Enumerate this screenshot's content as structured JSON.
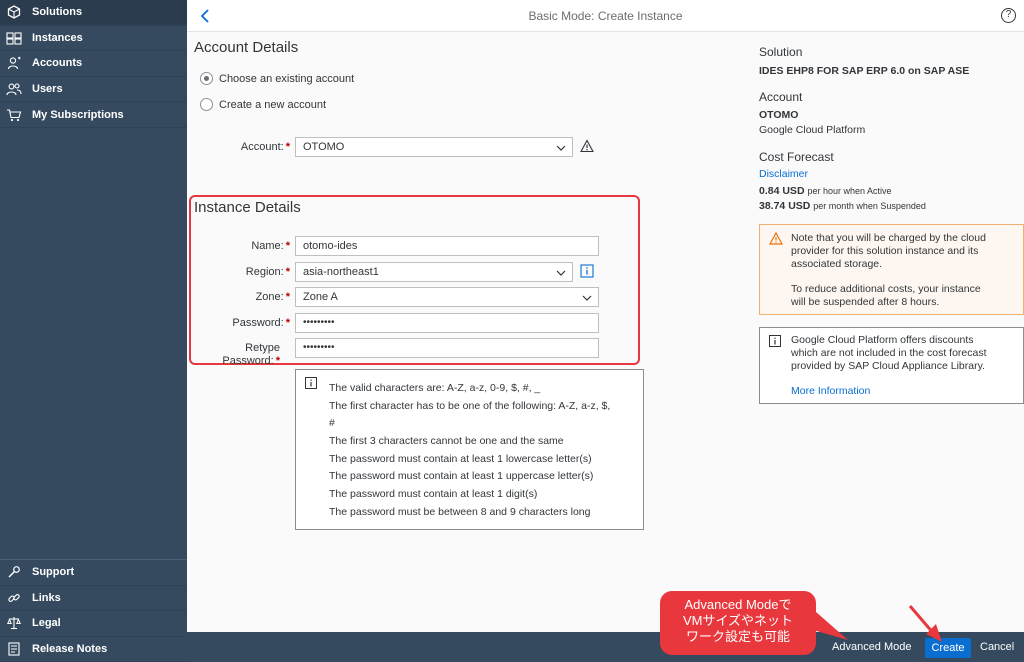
{
  "sidebar": {
    "top_items": [
      {
        "label": "Solutions",
        "icon": "solutions-icon"
      },
      {
        "label": "Instances",
        "icon": "instances-icon"
      },
      {
        "label": "Accounts",
        "icon": "accounts-icon"
      },
      {
        "label": "Users",
        "icon": "users-icon"
      },
      {
        "label": "My Subscriptions",
        "icon": "cart-icon"
      }
    ],
    "bottom_items": [
      {
        "label": "Support",
        "icon": "support-icon"
      },
      {
        "label": "Links",
        "icon": "link-icon"
      },
      {
        "label": "Legal",
        "icon": "legal-icon"
      },
      {
        "label": "Release Notes",
        "icon": "release-notes-icon"
      }
    ]
  },
  "header": {
    "title": "Basic Mode: Create Instance",
    "help": "?"
  },
  "account": {
    "title": "Account Details",
    "option_existing": "Choose an existing account",
    "option_new": "Create a new account",
    "account_label": "Account:",
    "account_value": "OTOMO"
  },
  "instance": {
    "title": "Instance Details",
    "name_label": "Name:",
    "name_value": "otomo-ides",
    "region_label": "Region:",
    "region_value": "asia-northeast1",
    "zone_label": "Zone:",
    "zone_value": "Zone A",
    "password_label": "Password:",
    "password_value": "•••••••••",
    "retype_label_1": "Retype",
    "retype_label_2": "Password:",
    "retype_value": "•••••••••"
  },
  "password_rules": [
    "The valid characters are: A-Z, a-z, 0-9, $, #, _",
    "The first character has to be one of the following: A-Z, a-z, $,",
    "#",
    "The first 3 characters cannot be one and the same",
    "The password must contain at least 1 lowercase letter(s)",
    "The password must contain at least 1 uppercase letter(s)",
    "The password must contain at least 1 digit(s)",
    "The password must be between 8 and 9 characters long"
  ],
  "right_panel": {
    "solution_head": "Solution",
    "solution_value": "IDES EHP8 FOR SAP ERP 6.0 on SAP ASE",
    "account_head": "Account",
    "account_value": "OTOMO",
    "account_provider": "Google Cloud Platform",
    "cost_head": "Cost Forecast",
    "disclaimer": "Disclaimer",
    "cost_hour_value": "0.84 USD",
    "cost_hour_suffix": "per hour when Active",
    "cost_month_value": "38.74 USD",
    "cost_month_suffix": "per month when Suspended",
    "warning_lines": [
      "Note that you will be charged by the cloud",
      "provider for this solution instance and its",
      "associated storage.",
      "To reduce additional costs, your instance",
      "will be suspended after 8 hours."
    ],
    "info_lines": [
      "Google Cloud Platform offers discounts",
      "which are not included in the cost forecast",
      "provided by SAP Cloud Appliance Library."
    ],
    "more_info": "More Information"
  },
  "footer": {
    "advanced_mode": "Advanced Mode",
    "create": "Create",
    "cancel": "Cancel"
  },
  "callout": {
    "line1": "Advanced Modeで",
    "line2": "VMサイズやネット",
    "line3": "ワーク設定も可能"
  },
  "colors": {
    "sidebar_bg": "#354a5f",
    "accent_blue": "#0a6ed1",
    "highlight_red": "#e8383d",
    "required_red": "#bb0000"
  }
}
